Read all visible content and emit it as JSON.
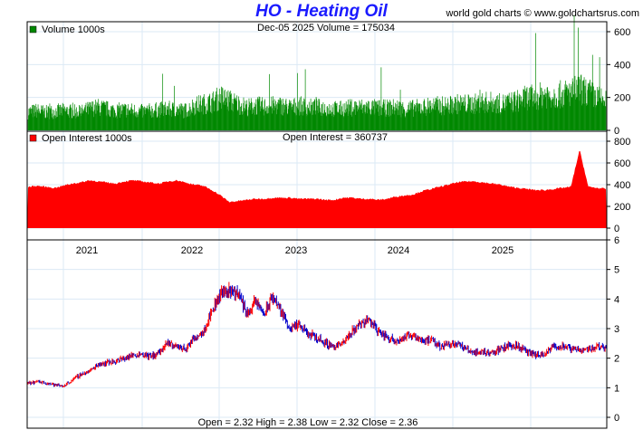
{
  "title": "HO  -  Heating Oil",
  "site": "world gold charts © www.goldchartsrus.com",
  "colors": {
    "volume": "#008800",
    "open_interest": "#ff0000",
    "up": "#ff0000",
    "down": "#0000cc",
    "grid": "#dbeaf5"
  },
  "chart_data": [
    {
      "type": "bar",
      "name": "volume",
      "legend": "Volume  1000s",
      "readout": "Dec-05  2025   Volume = 175034",
      "yticks": [
        0,
        200,
        400,
        600
      ],
      "ylim": [
        0,
        650
      ],
      "x_start": "2020-06",
      "frequency": "monthly",
      "values": [
        110,
        120,
        110,
        115,
        120,
        115,
        110,
        130,
        140,
        130,
        120,
        125,
        120,
        115,
        120,
        125,
        130,
        125,
        120,
        150,
        160,
        170,
        200,
        180,
        160,
        140,
        150,
        145,
        150,
        150,
        140,
        150,
        140,
        140,
        135,
        130,
        130,
        140,
        140,
        140,
        135,
        135,
        140,
        130,
        135,
        140,
        150,
        150,
        150,
        160,
        160,
        160,
        170,
        170,
        160,
        170,
        180,
        200,
        200,
        220,
        210,
        220,
        230,
        250,
        230,
        200,
        175
      ]
    },
    {
      "type": "area",
      "name": "open_interest",
      "legend": "Open Interest  1000s",
      "readout": "Open Interest = 360737",
      "yticks": [
        0,
        200,
        400,
        600,
        800
      ],
      "ylim": [
        0,
        820
      ],
      "x_start": "2020-06",
      "frequency": "monthly",
      "values": [
        380,
        390,
        380,
        370,
        390,
        410,
        420,
        440,
        430,
        420,
        410,
        430,
        440,
        430,
        420,
        410,
        430,
        440,
        420,
        400,
        390,
        350,
        300,
        240,
        250,
        260,
        270,
        270,
        280,
        280,
        280,
        270,
        270,
        270,
        260,
        260,
        280,
        280,
        270,
        270,
        260,
        270,
        290,
        300,
        310,
        340,
        360,
        380,
        400,
        420,
        430,
        430,
        420,
        410,
        400,
        380,
        370,
        360,
        350,
        350,
        360,
        370,
        380,
        720,
        380,
        370,
        361
      ]
    },
    {
      "type": "candlestick",
      "name": "price",
      "readout": "Open = 2.32    High = 2.38    Low = 2.32    Close = 2.36",
      "yticks": [
        0,
        1,
        2,
        3,
        4,
        5,
        6
      ],
      "ylim": [
        0,
        6
      ],
      "xticks": [
        "2021",
        "2022",
        "2023",
        "2024",
        "2025"
      ],
      "x_start": "2020-06",
      "frequency": "monthly",
      "close": [
        1.15,
        1.2,
        1.18,
        1.1,
        1.05,
        1.25,
        1.45,
        1.55,
        1.8,
        1.85,
        1.9,
        2.0,
        2.1,
        2.15,
        2.05,
        2.2,
        2.5,
        2.4,
        2.3,
        2.7,
        2.9,
        3.6,
        4.2,
        4.3,
        4.2,
        3.5,
        3.9,
        3.5,
        4.1,
        3.5,
        3.0,
        3.1,
        2.8,
        2.7,
        2.5,
        2.4,
        2.5,
        2.9,
        3.2,
        3.3,
        2.9,
        2.7,
        2.6,
        2.7,
        2.8,
        2.6,
        2.6,
        2.4,
        2.5,
        2.5,
        2.3,
        2.2,
        2.2,
        2.2,
        2.3,
        2.45,
        2.4,
        2.2,
        2.1,
        2.1,
        2.4,
        2.4,
        2.3,
        2.3,
        2.3,
        2.4,
        2.36
      ]
    }
  ]
}
